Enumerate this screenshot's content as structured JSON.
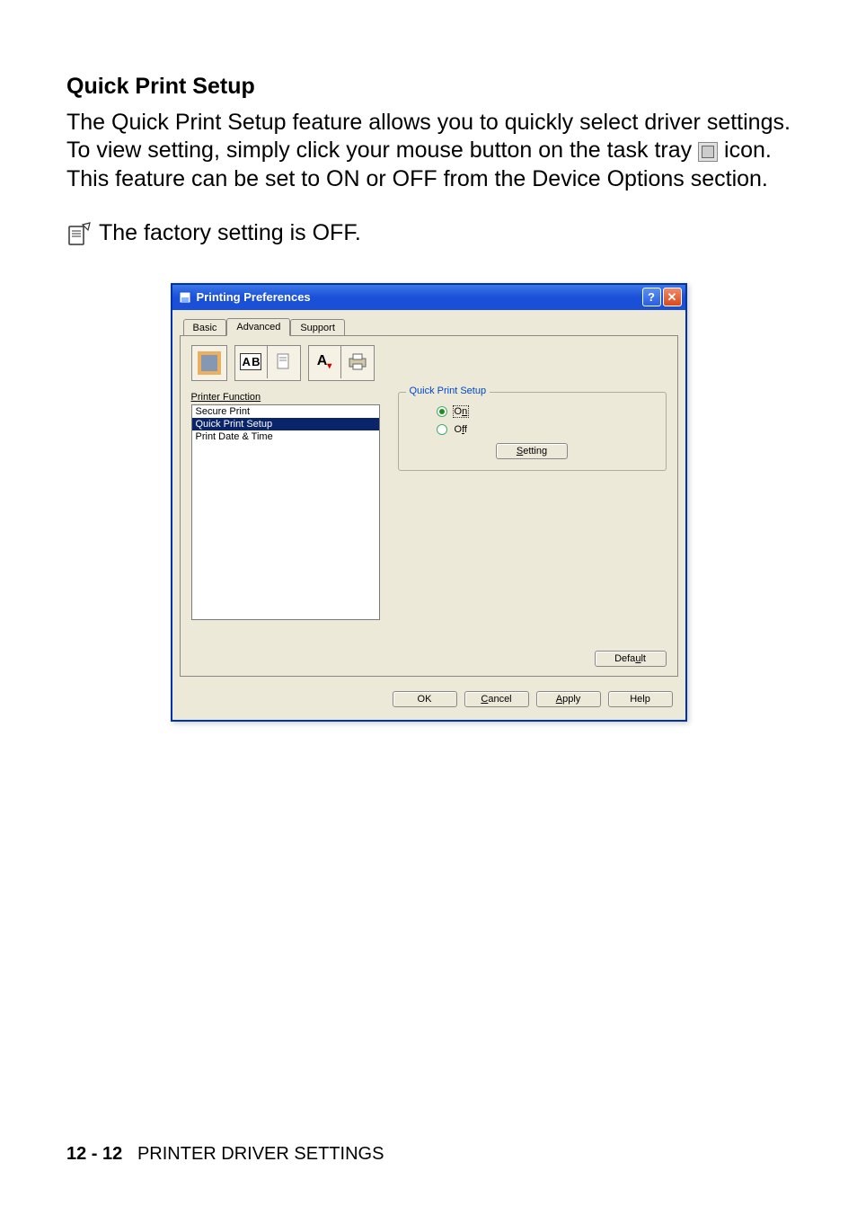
{
  "heading": "Quick Print Setup",
  "body": {
    "line1": "The Quick Print Setup feature allows you to quickly select driver settings. To view setting, simply click your mouse button on the task tray",
    "line2": "icon. This feature can be set to ON or OFF from the Device Options section."
  },
  "note": "The factory setting is OFF.",
  "dialog": {
    "title": "Printing Preferences",
    "help_glyph": "?",
    "close_glyph": "✕",
    "tabs": {
      "basic": "Basic",
      "advanced": "Advanced",
      "support": "Support"
    },
    "toolbar": {
      "ab": "A B",
      "av": "A"
    },
    "printer_function_label": "Printer Function",
    "printer_function_items": [
      "Secure Print",
      "Quick Print Setup",
      "Print Date & Time"
    ],
    "selected_item_index": 1,
    "group": {
      "legend": "Quick Print Setup",
      "on_label": "On",
      "off_label": "Off",
      "on_u": "n",
      "off_u": "f",
      "setting_btn": "Setting",
      "setting_u": "S"
    },
    "buttons": {
      "default": "Default",
      "default_u": "u",
      "ok": "OK",
      "cancel": "Cancel",
      "cancel_u": "C",
      "apply": "Apply",
      "apply_u": "A",
      "help": "Help"
    }
  },
  "footer": {
    "pagenum": "12 - 12",
    "section": "PRINTER DRIVER SETTINGS"
  }
}
